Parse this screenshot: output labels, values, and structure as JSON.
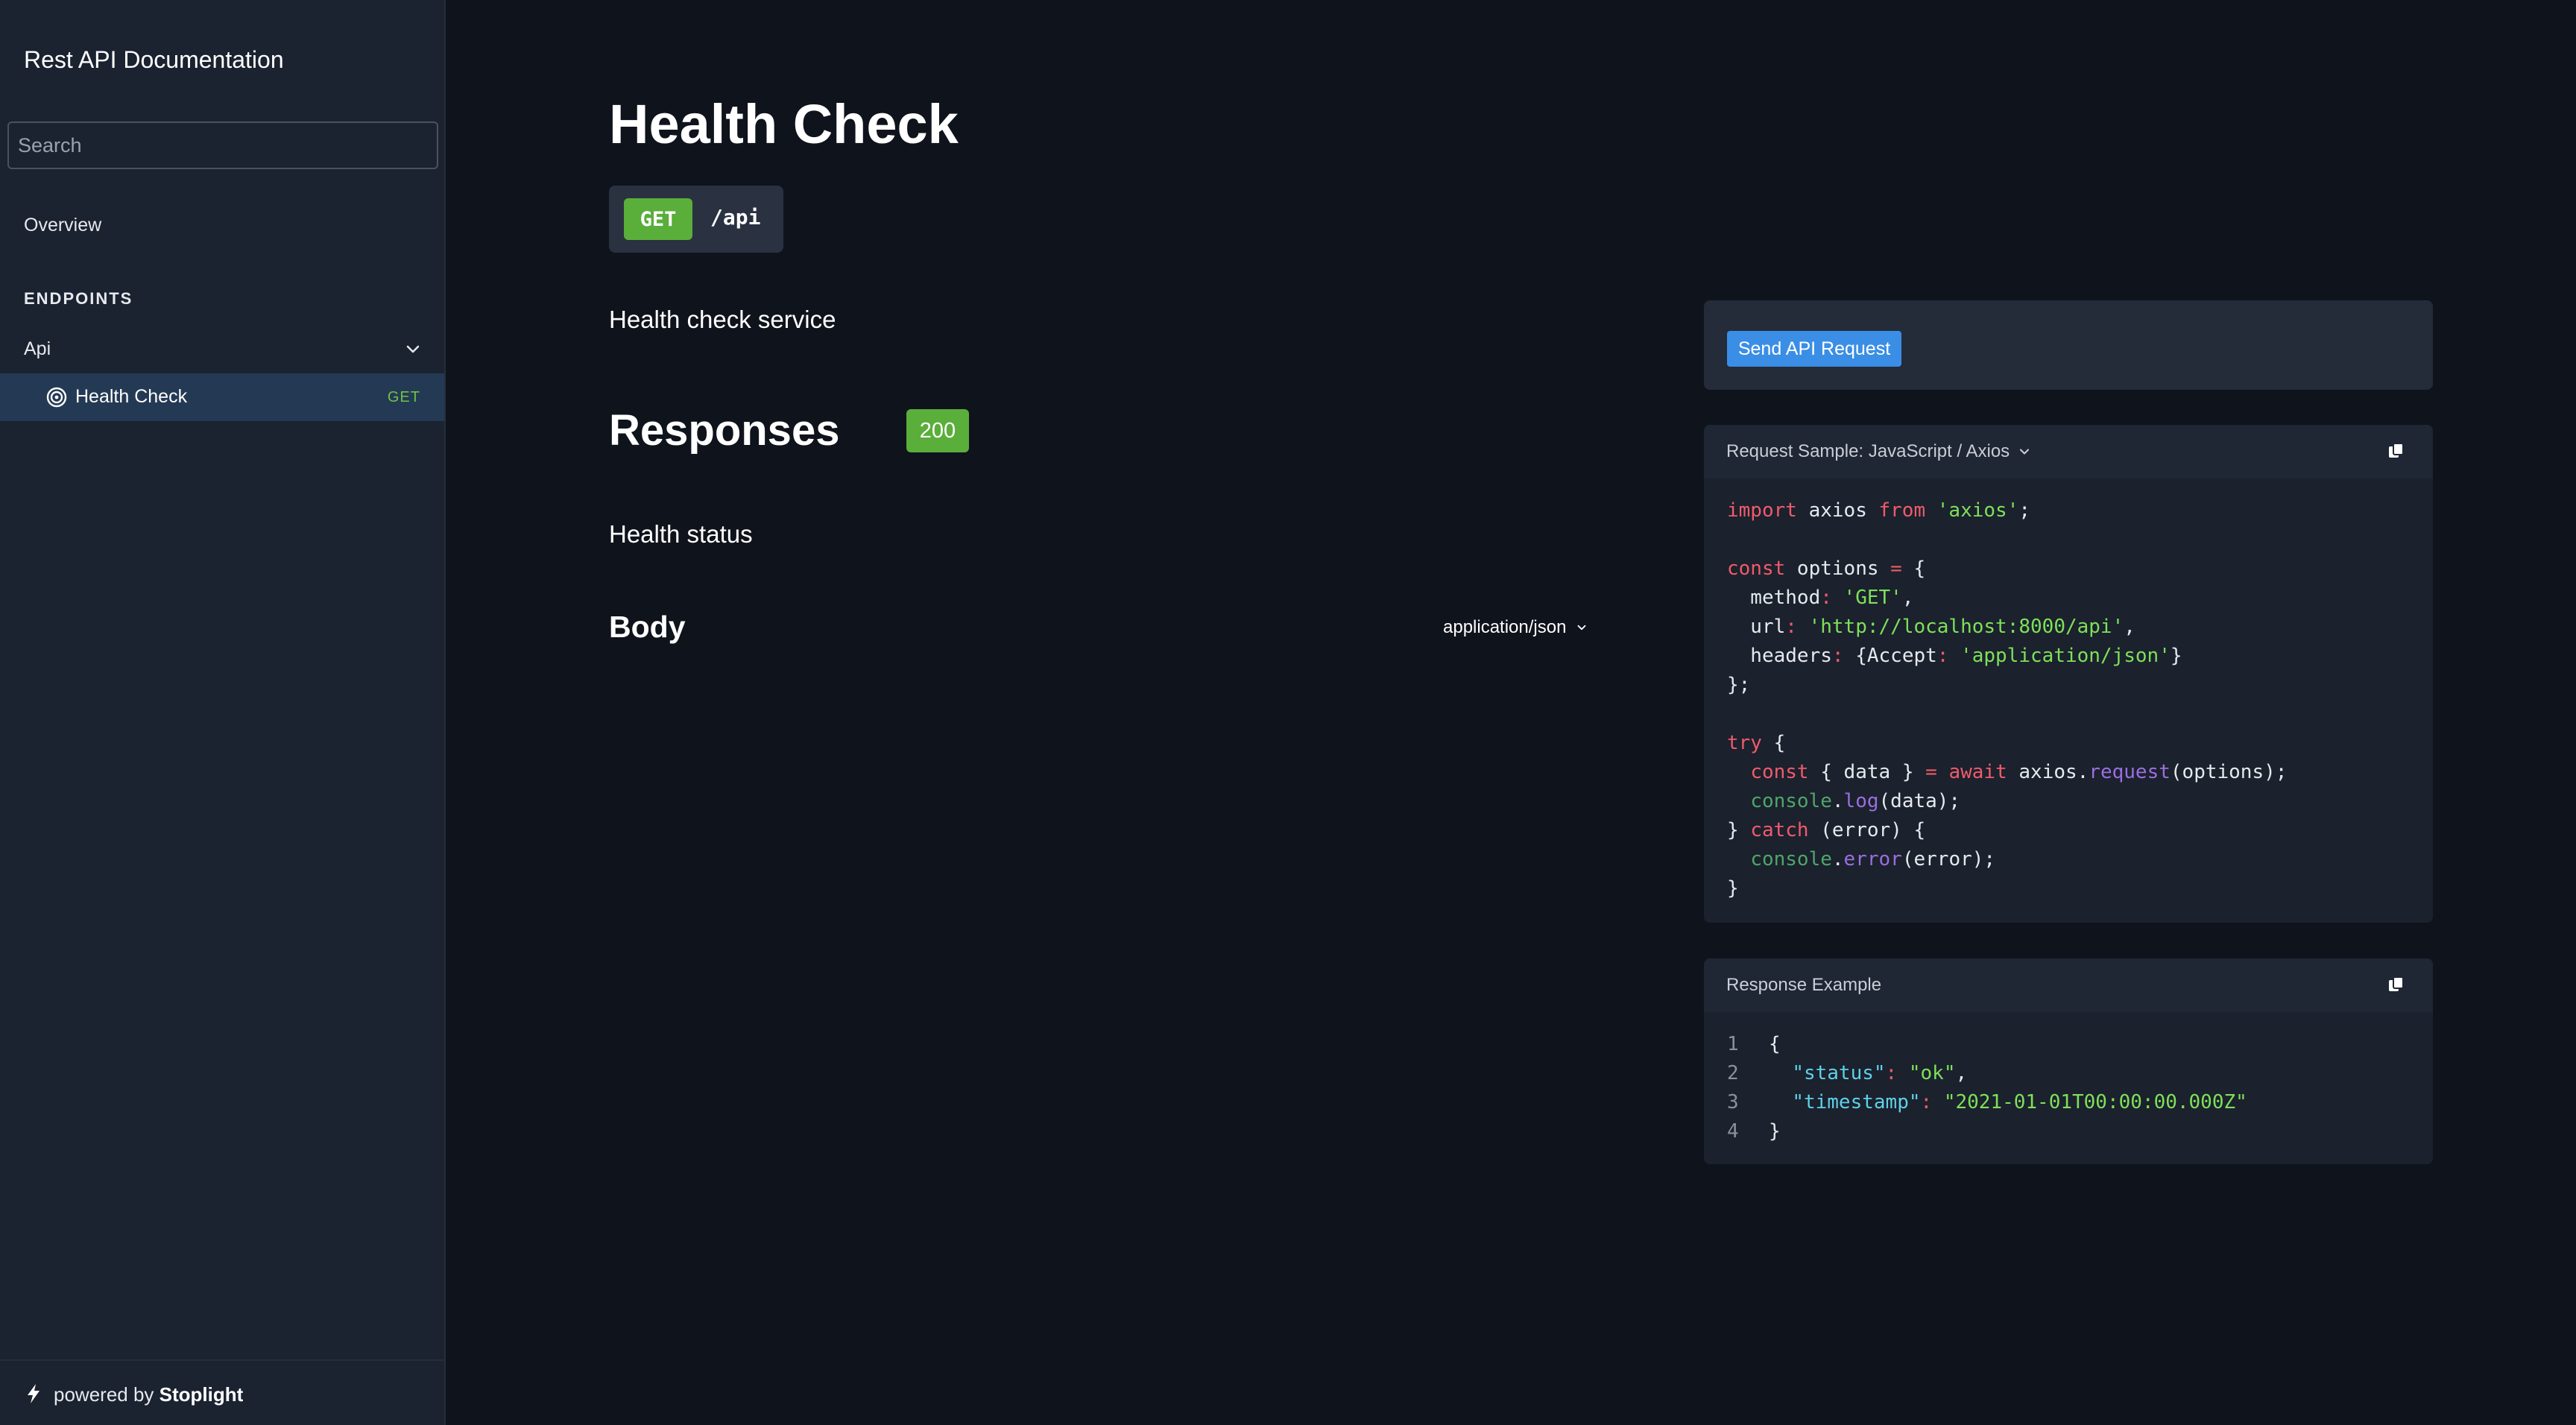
{
  "sidebar": {
    "title": "Rest API Documentation",
    "search_placeholder": "Search",
    "overview": "Overview",
    "section_label": "ENDPOINTS",
    "group_label": "Api",
    "active_item": {
      "label": "Health Check",
      "method": "GET"
    },
    "footer": {
      "prefix": "powered by",
      "brand": "Stoplight"
    }
  },
  "main": {
    "title": "Health Check",
    "method": "GET",
    "path": "/api",
    "description": "Health check service",
    "responses_title": "Responses",
    "status_code": "200",
    "response_description": "Health status",
    "body_title": "Body",
    "content_type": "application/json"
  },
  "panel": {
    "send_button": "Send API Request",
    "request_sample_title": "Request Sample: JavaScript / Axios",
    "request_code": [
      "import axios from 'axios';",
      "",
      "const options = {",
      "  method: 'GET',",
      "  url: 'http://localhost:8000/api',",
      "  headers: {Accept: 'application/json'}",
      "};",
      "",
      "try {",
      "  const { data } = await axios.request(options);",
      "  console.log(data);",
      "} catch (error) {",
      "  console.error(error);",
      "}"
    ],
    "response_example_title": "Response Example",
    "response_lines": [
      {
        "num": "1",
        "text": "{"
      },
      {
        "num": "2",
        "text": "  \"status\": \"ok\","
      },
      {
        "num": "3",
        "text": "  \"timestamp\": \"2021-01-01T00:00:00.000Z\""
      },
      {
        "num": "4",
        "text": "}"
      }
    ]
  },
  "colors": {
    "background": "#0f131c",
    "sidebar": "#1b2230",
    "active_item": "#243a54",
    "method_get": "#5aae3a",
    "send_button": "#3a8ee6"
  },
  "icons": [
    "chevron-down-icon",
    "target-icon",
    "bolt-icon",
    "copy-icon"
  ]
}
